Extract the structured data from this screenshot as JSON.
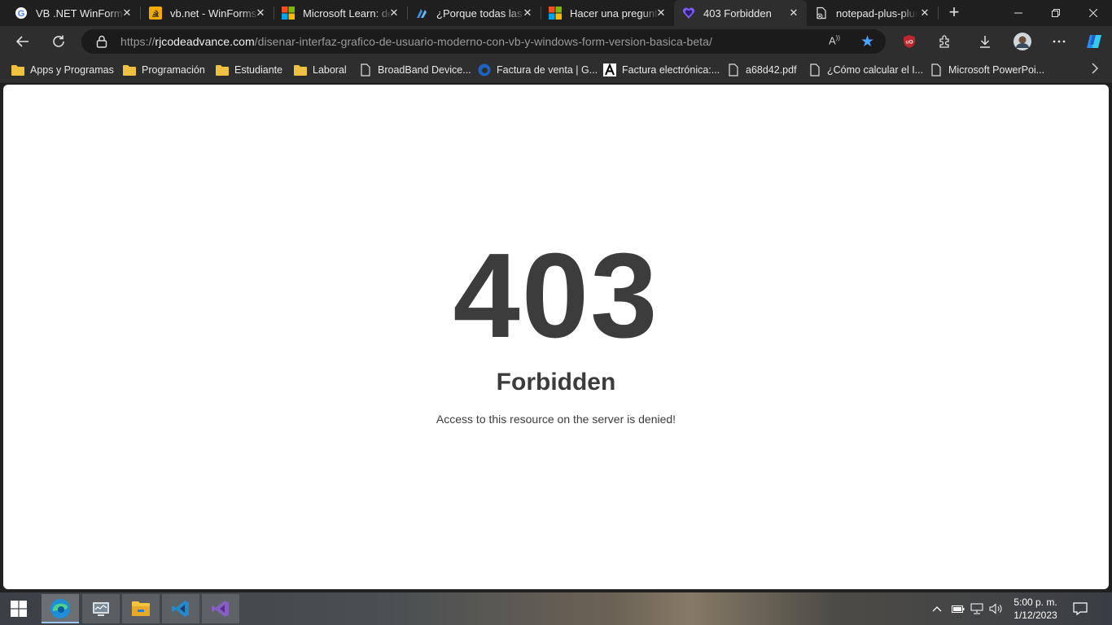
{
  "tabs": [
    {
      "title": "VB .NET WinForm M",
      "icon": "google-icon"
    },
    {
      "title": "vb.net - WinForms",
      "icon": "stackoverflow-icon"
    },
    {
      "title": "Microsoft Learn: de",
      "icon": "microsoft-icon"
    },
    {
      "title": "¿Porque todas las p",
      "icon": "devcommunity-icon"
    },
    {
      "title": "Hacer una pregunta",
      "icon": "microsoft-icon"
    },
    {
      "title": "403 Forbidden",
      "icon": "heart-shield-icon",
      "active": true
    },
    {
      "title": "notepad-plus-plus",
      "icon": "page-icon"
    }
  ],
  "address": {
    "scheme": "https://",
    "host": "rjcodeadvance.com",
    "path": "/disenar-interfaz-grafico-de-usuario-moderno-con-vb-y-windows-form-version-basica-beta/"
  },
  "favorites": [
    {
      "label": "Apps y Programas",
      "icon": "folder-icon"
    },
    {
      "label": "Programación",
      "icon": "folder-icon"
    },
    {
      "label": "Estudiante",
      "icon": "folder-icon"
    },
    {
      "label": "Laboral",
      "icon": "folder-icon"
    },
    {
      "label": "BroadBand Device...",
      "icon": "page-icon"
    },
    {
      "label": "Factura de venta | G...",
      "icon": "edge-e-icon"
    },
    {
      "label": "Factura electrónica:...",
      "icon": "a-logo-icon"
    },
    {
      "label": "a68d42.pdf",
      "icon": "page-icon"
    },
    {
      "label": "¿Cómo calcular el I...",
      "icon": "page-icon"
    },
    {
      "label": "Microsoft PowerPoi...",
      "icon": "page-icon"
    }
  ],
  "page": {
    "code": "403",
    "heading": "Forbidden",
    "message": "Access to this resource on the server is denied!"
  },
  "clock": {
    "time": "5:00 p. m.",
    "date": "1/12/2023"
  },
  "colors": {
    "edge_star": "#4da3ff",
    "page_text": "#3c3c3c",
    "ublock_red": "#c0262d"
  }
}
